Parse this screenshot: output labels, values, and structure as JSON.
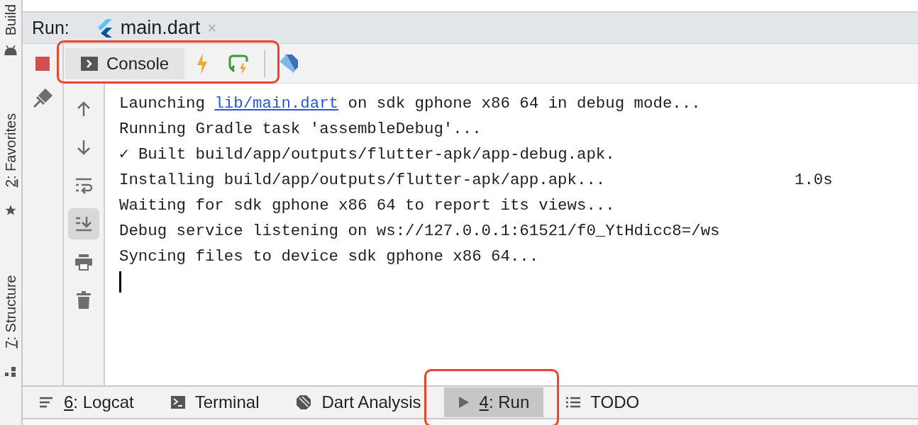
{
  "side_tabs": [
    {
      "label": "Build",
      "kind": "android"
    },
    {
      "mnemonic": "2",
      "label": ": Favorites",
      "kind": "star"
    },
    {
      "mnemonic": "7",
      "label": ": Structure",
      "kind": "structure"
    }
  ],
  "run_header": {
    "label": "Run:",
    "tab": {
      "title": "main.dart",
      "close": "×"
    }
  },
  "toolbar": {
    "console_tab": {
      "label": "Console",
      "selected": true
    }
  },
  "console": {
    "lines": [
      {
        "before": "Launching ",
        "link": "lib/main.dart",
        "after": " on sdk gphone x86 64 in debug mode..."
      },
      {
        "before": "Running Gradle task 'assembleDebug'..."
      },
      {
        "before": "✓ Built build/app/outputs/flutter-apk/app-debug.apk."
      },
      {
        "before": "Installing build/app/outputs/flutter-apk/app.apk...",
        "duration": "1.0s"
      },
      {
        "before": "Waiting for sdk gphone x86 64 to report its views..."
      },
      {
        "before": "Debug service listening on ws://127.0.0.1:61521/f0_YtHdicc8=/ws"
      },
      {
        "before": "Syncing files to device sdk gphone x86 64..."
      }
    ]
  },
  "side_actions": [
    {
      "kind": "up",
      "selected": false
    },
    {
      "kind": "down",
      "selected": false
    },
    {
      "kind": "wrap",
      "selected": false
    },
    {
      "kind": "scroll-end",
      "selected": true
    },
    {
      "kind": "print",
      "selected": false
    },
    {
      "kind": "trash",
      "selected": false
    }
  ],
  "bottom_tabs": [
    {
      "kind": "logcat",
      "mnemonic": "6",
      "label": ": Logcat",
      "selected": false
    },
    {
      "kind": "terminal",
      "label": "Terminal",
      "selected": false
    },
    {
      "kind": "dart",
      "label": "Dart Analysis",
      "selected": false
    },
    {
      "kind": "run",
      "mnemonic": "4",
      "label": ": Run",
      "selected": true
    },
    {
      "kind": "todo",
      "label": "TODO",
      "selected": false
    }
  ]
}
